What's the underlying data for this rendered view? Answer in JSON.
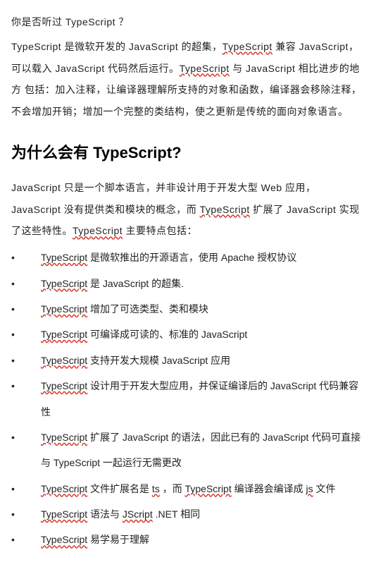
{
  "intro": {
    "q": "你是否听过 TypeScript ？",
    "p1_a": "TypeScript 是微软开发的 JavaScript 的超集，",
    "p1_b": "TypeScript",
    "p1_c": " 兼容 JavaScript，可以载入 JavaScript 代码然后运行。",
    "p1_d": "TypeScript",
    "p1_e": " 与 JavaScript 相比进步的地方 包括：加入注释，让编译器理解所支持的对象和函数，编译器会移除注释，不会增加开销；增加一个完整的类结构，使之更新是传统的面向对象语言。"
  },
  "heading": "为什么会有 TypeScript?",
  "why": {
    "a": "JavaScript 只是一个脚本语言，并非设计用于开发大型 Web 应用，JavaScript 没有提供类和模块的概念，而 ",
    "b": "TypeScript",
    "c": " 扩展了 JavaScript 实现了这些特性。",
    "d": "TypeScript",
    "e": " 主要特点包括："
  },
  "items": [
    {
      "a": "TypeScript",
      "b": " 是微软推出的开源语言，使用 Apache 授权协议"
    },
    {
      "a": "TypeScript",
      "b": " 是 JavaScript 的超集."
    },
    {
      "a": "TypeScript",
      "b": " 增加了可选类型、类和模块"
    },
    {
      "a": "TypeScript",
      "b": " 可编译成可读的、标准的 JavaScript"
    },
    {
      "a": "TypeScript",
      "b": " 支持开发大规模 JavaScript 应用"
    },
    {
      "a": "TypeScript",
      "b": " 设计用于开发大型应用，并保证编译后的 JavaScript 代码兼容性"
    },
    {
      "a": "TypeScript",
      "b": " 扩展了 JavaScript 的语法，因此已有的 JavaScript 代码可直接与 TypeScript 一起运行无需更改"
    },
    {
      "a": "TypeScript",
      "b": " 文件扩展名是 ",
      "c": "ts",
      "d": " ，而 ",
      "e": "TypeScript",
      "f": " 编译器会编译成 ",
      "g": "js",
      "h": " 文件"
    },
    {
      "a": "TypeScript",
      "b": " 语法与 ",
      "c": "JScript",
      "d": " .NET 相同"
    },
    {
      "a": "TypeScript",
      "b": " 易学易于理解"
    }
  ]
}
